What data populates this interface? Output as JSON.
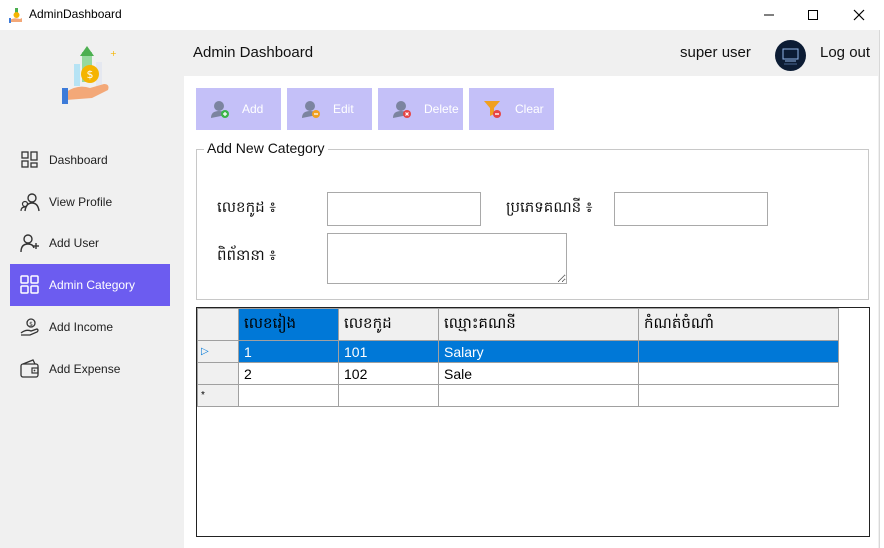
{
  "window": {
    "title": "AdminDashboard",
    "controls": {
      "minimize": "—",
      "maximize": "☐",
      "close": "✕"
    }
  },
  "sidebar": {
    "logo_icon": "money-hand-icon",
    "items": [
      {
        "label": "Dashboard",
        "icon": "dashboard-icon",
        "active": false
      },
      {
        "label": "View Profile",
        "icon": "profile-icon",
        "active": false
      },
      {
        "label": "Add User",
        "icon": "add-user-icon",
        "active": false
      },
      {
        "label": "Admin Category",
        "icon": "category-grid-icon",
        "active": true
      },
      {
        "label": "Add Income",
        "icon": "income-icon",
        "active": false
      },
      {
        "label": "Add Expense",
        "icon": "wallet-icon",
        "active": false
      }
    ]
  },
  "header": {
    "title": "Admin Dashboard",
    "user_name": "super user",
    "logout_label": "Log out"
  },
  "toolbar": {
    "add_label": "Add",
    "edit_label": "Edit",
    "delete_label": "Delete",
    "clear_label": "Clear"
  },
  "form": {
    "legend": "Add New Category",
    "code_label": "លេខកូដ ៖",
    "type_label": "ប្រភេទគណនី ៖",
    "desc_label": "ពិព័នានា ៖",
    "code_value": "",
    "type_value": "",
    "desc_value": ""
  },
  "grid": {
    "columns": [
      "លេខរៀង",
      "លេខកូដ",
      "ឈ្មោះគណនី",
      "កំណត់ចំណាំ"
    ],
    "rows": [
      {
        "no": "1",
        "code": "101",
        "name": "Salary",
        "note": "",
        "selected": true
      },
      {
        "no": "2",
        "code": "102",
        "name": "Sale",
        "note": "",
        "selected": false
      }
    ],
    "new_row_marker": "*",
    "selected_row_marker": "▷"
  },
  "colors": {
    "accent": "#6c5cf0",
    "toolbar_button": "#c4c0f8",
    "selection": "#0078d7"
  }
}
